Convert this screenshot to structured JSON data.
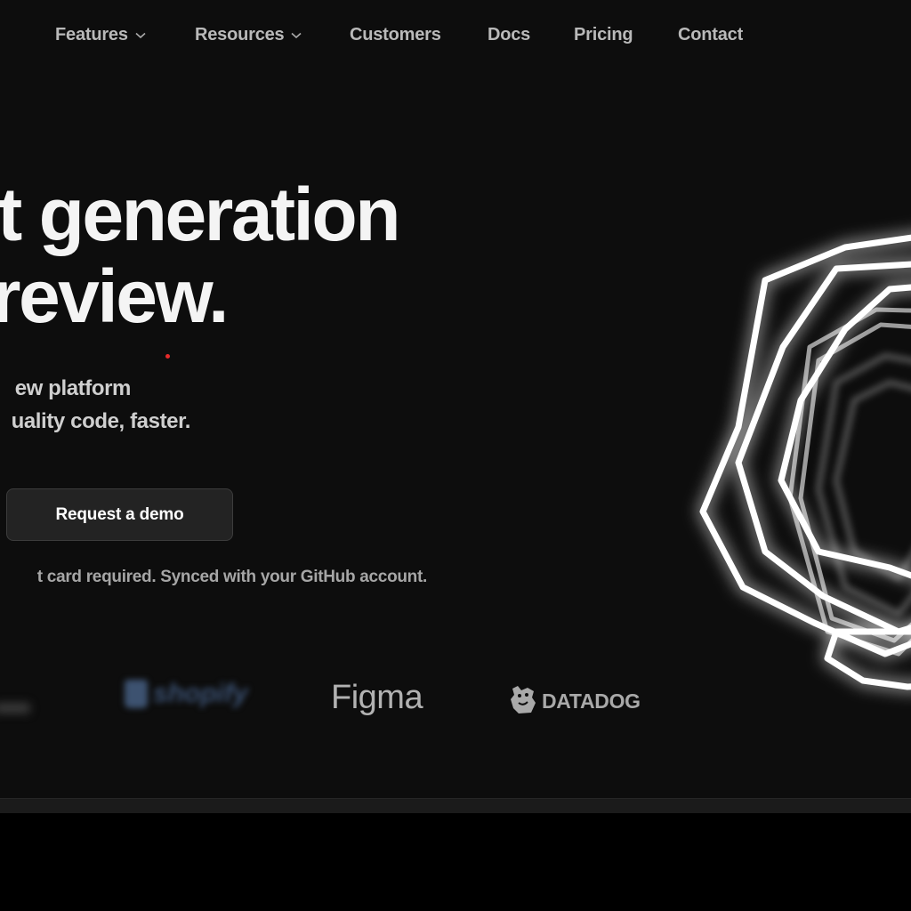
{
  "nav": {
    "items": [
      {
        "label": "Features",
        "dropdown": true
      },
      {
        "label": "Resources",
        "dropdown": true
      },
      {
        "label": "Customers",
        "dropdown": false
      },
      {
        "label": "Docs",
        "dropdown": false
      },
      {
        "label": "Pricing",
        "dropdown": false
      },
      {
        "label": "Contact",
        "dropdown": false
      }
    ]
  },
  "hero": {
    "title_line1": "t generation",
    "title_line2": "review.",
    "subtitle_line1": "ew platform",
    "subtitle_line2": "uality code, faster.",
    "cta_label": "Request a demo",
    "note": "t card required. Synced with your GitHub account."
  },
  "logos": {
    "figma": "Figma",
    "datadog": "DATADOG",
    "shopify": "shopify"
  },
  "colors": {
    "background": "#0d0d0d",
    "accent_dot": "#e52a2a",
    "button_bg": "#232323"
  }
}
